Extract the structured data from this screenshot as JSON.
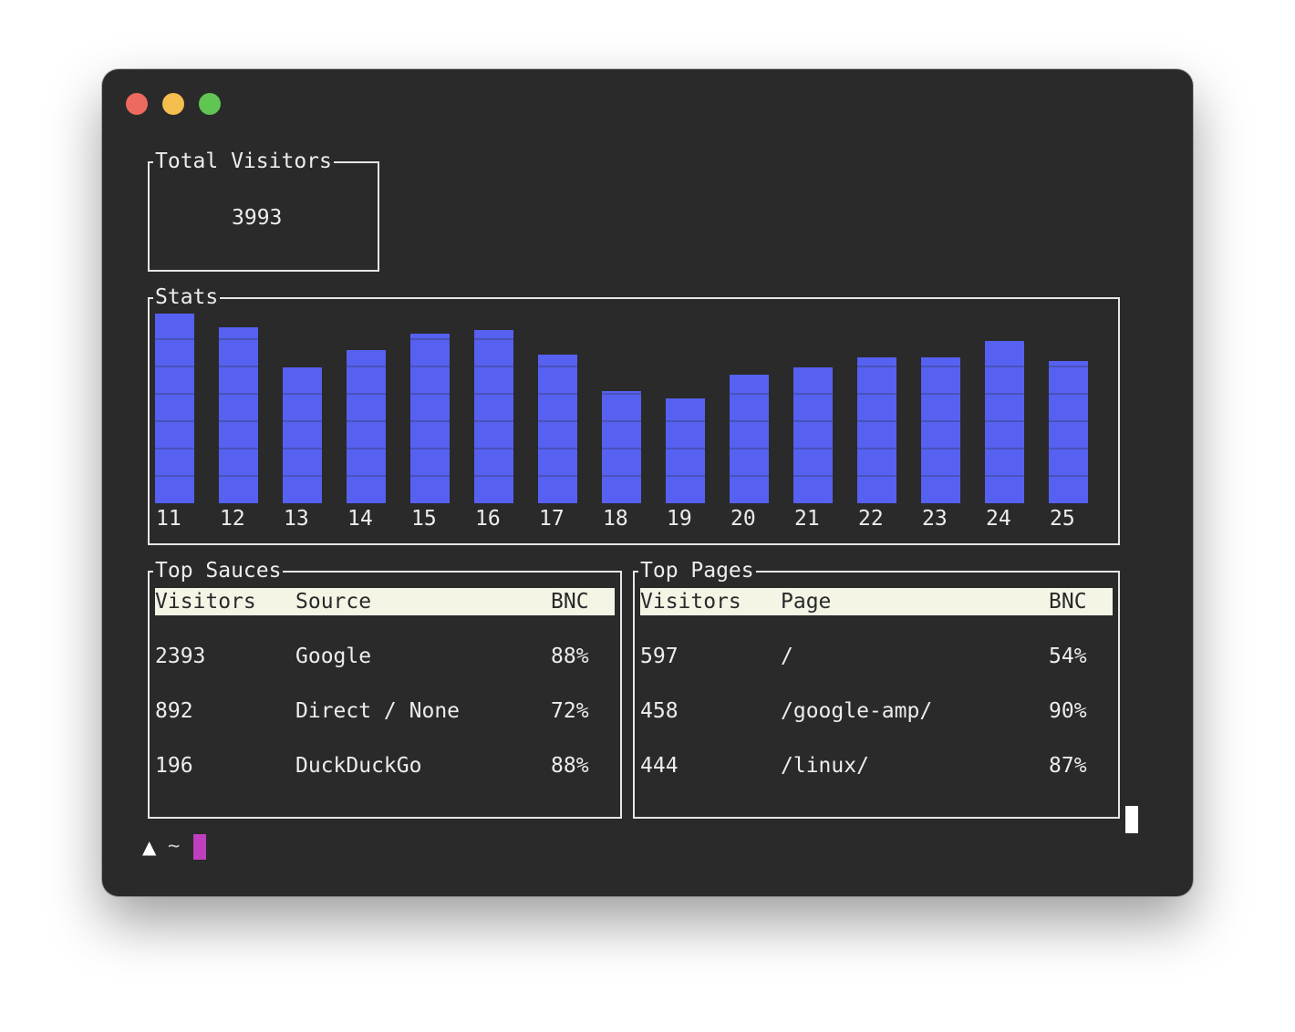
{
  "window": {
    "controls": [
      "close",
      "minimize",
      "zoom"
    ]
  },
  "total_visitors": {
    "title": "Total Visitors",
    "value": "3993"
  },
  "stats": {
    "title": "Stats",
    "bar_color": "#5661f1"
  },
  "chart_data": {
    "type": "bar",
    "categories": [
      "11",
      "12",
      "13",
      "14",
      "15",
      "16",
      "17",
      "18",
      "19",
      "20",
      "21",
      "22",
      "23",
      "24",
      "25"
    ],
    "values": [
      280,
      260,
      200,
      226,
      250,
      256,
      220,
      165,
      155,
      190,
      200,
      216,
      216,
      240,
      210
    ],
    "title": "Stats",
    "xlabel": "",
    "ylabel": "",
    "ylim": [
      0,
      280
    ],
    "grid": false
  },
  "top_sources": {
    "title": "Top Sauces",
    "headers": [
      "Visitors",
      "Source",
      "BNC"
    ],
    "rows": [
      [
        "2393",
        "Google",
        "88%"
      ],
      [
        "892",
        "Direct / None",
        "72%"
      ],
      [
        "196",
        "DuckDuckGo",
        "88%"
      ]
    ]
  },
  "top_pages": {
    "title": "Top Pages",
    "headers": [
      "Visitors",
      "Page",
      "BNC"
    ],
    "rows": [
      [
        "597",
        "/",
        "54%"
      ],
      [
        "458",
        "/google-amp/",
        "90%"
      ],
      [
        "444",
        "/linux/",
        "87%"
      ]
    ]
  },
  "prompt": {
    "arrow": "▲",
    "tilde": "~"
  },
  "colors": {
    "terminal_bg": "#2a2a2a",
    "header_bg": "#f5f5e6",
    "prompt_cursor": "#c03fbf"
  }
}
